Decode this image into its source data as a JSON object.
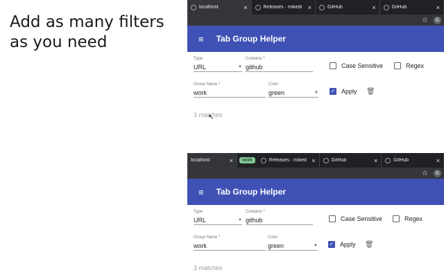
{
  "headline": {
    "line1": "Add as many filters",
    "line2": "as you need"
  },
  "app": {
    "title": "Tab Group Helper"
  },
  "tabs_top": [
    {
      "title": "localhost"
    },
    {
      "title": "Releases · mikedi"
    },
    {
      "title": "GitHub"
    },
    {
      "title": "GitHub"
    }
  ],
  "tabs_bottom": {
    "first": "localhost",
    "group_chip": "work",
    "rest": [
      {
        "title": "Releases · miked"
      },
      {
        "title": "GitHub"
      },
      {
        "title": "GitHub"
      }
    ]
  },
  "icons": {
    "close": "×",
    "star": "☆",
    "avatar": "G",
    "menu": "≡",
    "caret": "▼",
    "trash": "🗑",
    "check": "✓",
    "cursor": "↖"
  },
  "colors": {
    "app_bar": "#3f51b5",
    "group_green": "#81c995",
    "tab_bg": "#202124"
  },
  "filter": {
    "type_label": "Type",
    "type_value": "URL",
    "contains_label": "Contains *",
    "contains_value": "github",
    "case_label": "Case Sensitive",
    "regex_label": "Regex",
    "group_label": "Group Name *",
    "group_value": "work",
    "color_label": "Color",
    "color_value": "green",
    "apply_label": "Apply",
    "matches": "3 matches"
  }
}
